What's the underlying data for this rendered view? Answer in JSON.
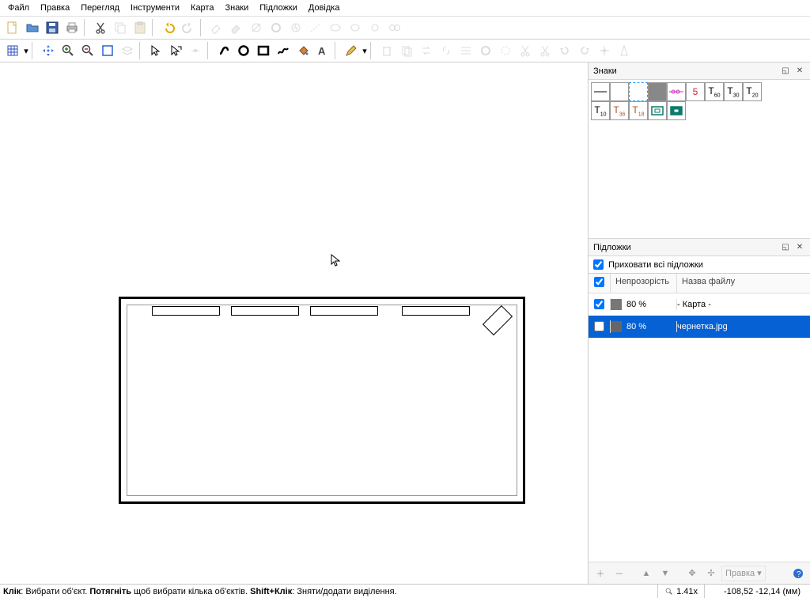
{
  "menu": [
    "Файл",
    "Правка",
    "Перегляд",
    "Інструменти",
    "Карта",
    "Знаки",
    "Підложки",
    "Довідка"
  ],
  "panels": {
    "signs_title": "Знаки",
    "layers_title": "Підложки",
    "hide_all_layers": "Приховати всі підложки"
  },
  "signs_row1": [
    {
      "name": "thin-line"
    },
    {
      "name": "empty"
    },
    {
      "name": "dashed-square",
      "sel": true
    },
    {
      "name": "grey-square",
      "grey": true
    },
    {
      "name": "chain"
    },
    {
      "name": "five",
      "label": "5",
      "color": "#d2233b"
    },
    {
      "name": "t60",
      "label": "T",
      "sub": "60"
    },
    {
      "name": "t30",
      "label": "T",
      "sub": "30"
    },
    {
      "name": "t20",
      "label": "T",
      "sub": "20"
    }
  ],
  "signs_row2": [
    {
      "name": "t10",
      "label": "T",
      "sub": "10"
    },
    {
      "name": "t36",
      "label": "T",
      "sub": "36",
      "color": "#b05028"
    },
    {
      "name": "t18",
      "label": "T",
      "sub": "18",
      "color": "#b05028"
    },
    {
      "name": "rel-open",
      "rel": "open"
    },
    {
      "name": "rel-filled",
      "rel": "filled"
    }
  ],
  "layers_header": {
    "checkbox": "",
    "opacity": "Непрозорість",
    "name": "Назва файлу"
  },
  "layers_rows": [
    {
      "checked": true,
      "opacity": "80 %",
      "name": "- Карта -",
      "sel": false
    },
    {
      "checked": false,
      "opacity": "80 %",
      "name": "чернетка.jpg",
      "sel": true
    }
  ],
  "layers_foot_edit": "Правка",
  "status": {
    "hint_parts": [
      "Клік",
      ": Вибрати об'єкт. ",
      "Потягніть",
      " щоб вибрати кілька об'єктів. ",
      "Shift+Клік",
      ": Зняти/додати виділення."
    ],
    "zoom": "1.41x",
    "coords": "-108,52  -12,14 (мм)"
  }
}
